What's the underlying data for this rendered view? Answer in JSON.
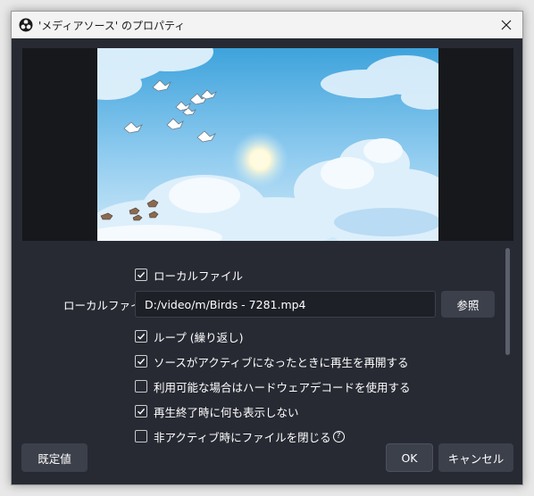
{
  "window": {
    "title": "'メディアソース' のプロパティ"
  },
  "properties": {
    "local_file_checkbox": {
      "label": "ローカルファイル",
      "checked": true
    },
    "local_file_label": "ローカルファイル",
    "local_file_value": "D:/video/m/Birds - 7281.mp4",
    "browse_label": "参照",
    "options": [
      {
        "label": "ループ (繰り返し)",
        "checked": true
      },
      {
        "label": "ソースがアクティブになったときに再生を再開する",
        "checked": true
      },
      {
        "label": "利用可能な場合はハードウェアデコードを使用する",
        "checked": false
      },
      {
        "label": "再生終了時に何も表示しない",
        "checked": true
      },
      {
        "label": "非アクティブ時にファイルを閉じる",
        "checked": false
      }
    ]
  },
  "footer": {
    "defaults_label": "既定値",
    "ok_label": "OK",
    "cancel_label": "キャンセル"
  },
  "icons": {
    "app": "obs-logo-icon",
    "close": "close-icon",
    "check": "checkmark-icon",
    "help": "help-icon"
  },
  "colors": {
    "background": "#272a33",
    "button": "#3c404b",
    "preview_bg": "#17181c"
  }
}
